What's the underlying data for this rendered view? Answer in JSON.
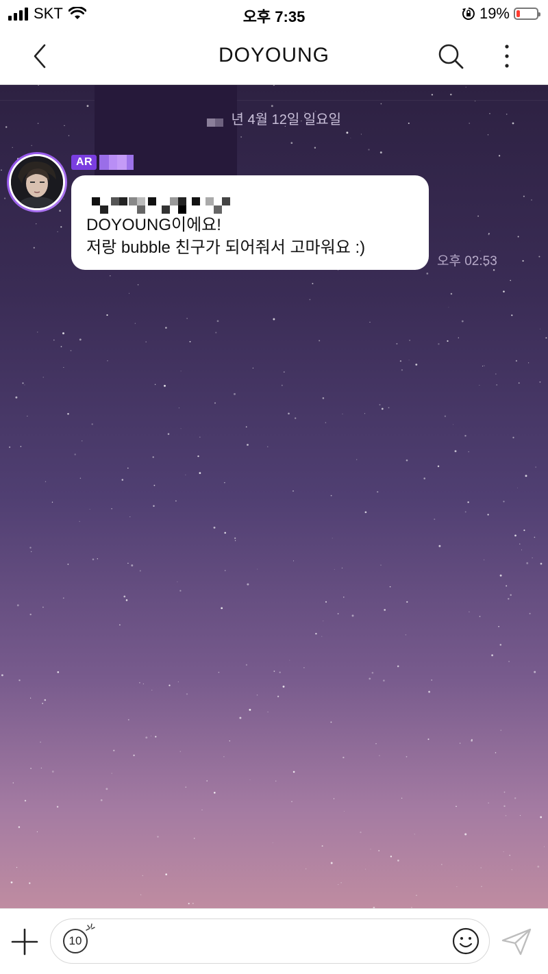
{
  "status_bar": {
    "carrier": "SKT",
    "time": "오후 7:35",
    "battery_percent": "19%",
    "battery_level": 0.19
  },
  "header": {
    "title": "DOYOUNG",
    "back_icon": "chevron-left-icon",
    "search_icon": "search-icon",
    "more_icon": "more-vertical-icon"
  },
  "chat": {
    "date_separator": "년 4월 12일 일요일",
    "messages": [
      {
        "sender_badge": "AR",
        "lines": [
          "DOYOUNG이에요!",
          "저랑 bubble 친구가 되어줘서 고마워요 :)"
        ],
        "time": "오후 02:53"
      }
    ]
  },
  "input": {
    "counter": "10",
    "placeholder": ""
  },
  "colors": {
    "badge": "#7a3ee0",
    "sky_top": "#2d2142",
    "sky_bottom": "#bf8ca1"
  }
}
